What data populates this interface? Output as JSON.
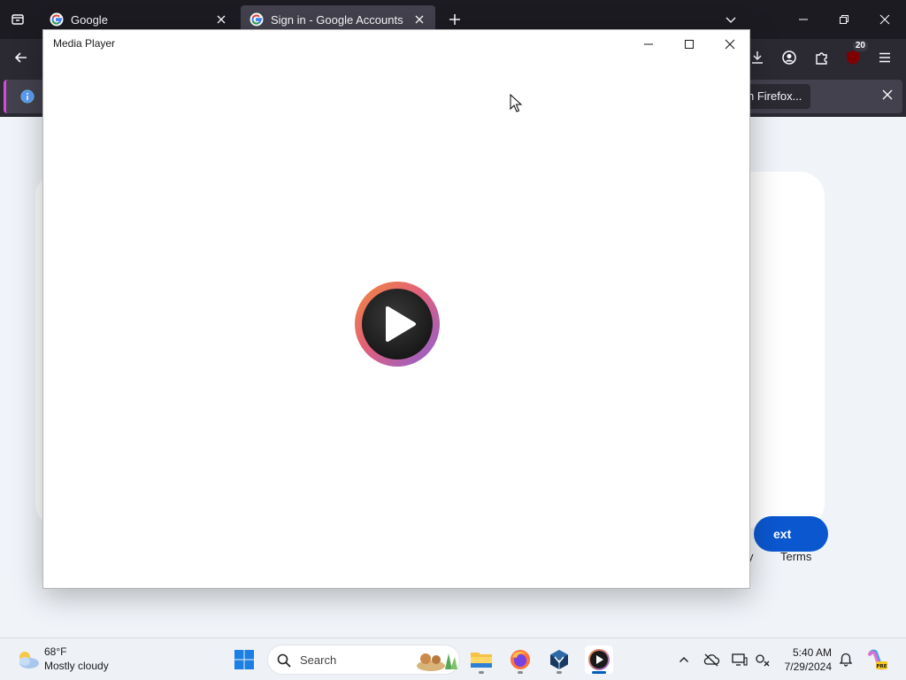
{
  "browser": {
    "tabs": [
      {
        "title": "Google",
        "active": false
      },
      {
        "title": "Sign in - Google Accounts",
        "active": true
      }
    ],
    "extension_badge": "20",
    "notification": {
      "message": "",
      "action_label": "h Firefox..."
    }
  },
  "page": {
    "next_button_label": "ext",
    "footer_terms": "Terms",
    "footer_partial": "y"
  },
  "media_player": {
    "title": "Media Player"
  },
  "taskbar": {
    "weather": {
      "temperature": "68°F",
      "condition": "Mostly cloudy"
    },
    "search_placeholder": "Search",
    "clock": {
      "time": "5:40 AM",
      "date": "7/29/2024"
    },
    "apps": [
      "windows-start",
      "file-explorer",
      "firefox",
      "virtualbox",
      "media-player"
    ],
    "active_app": "media-player"
  },
  "colors": {
    "firefox_tabbar": "#1c1b22",
    "firefox_toolbar": "#2b2a33",
    "google_next_blue": "#0b57d0",
    "page_bg": "#f0f4f9",
    "taskbar_bg": "#eef1f6",
    "notification_accent": "#d74ad8"
  }
}
